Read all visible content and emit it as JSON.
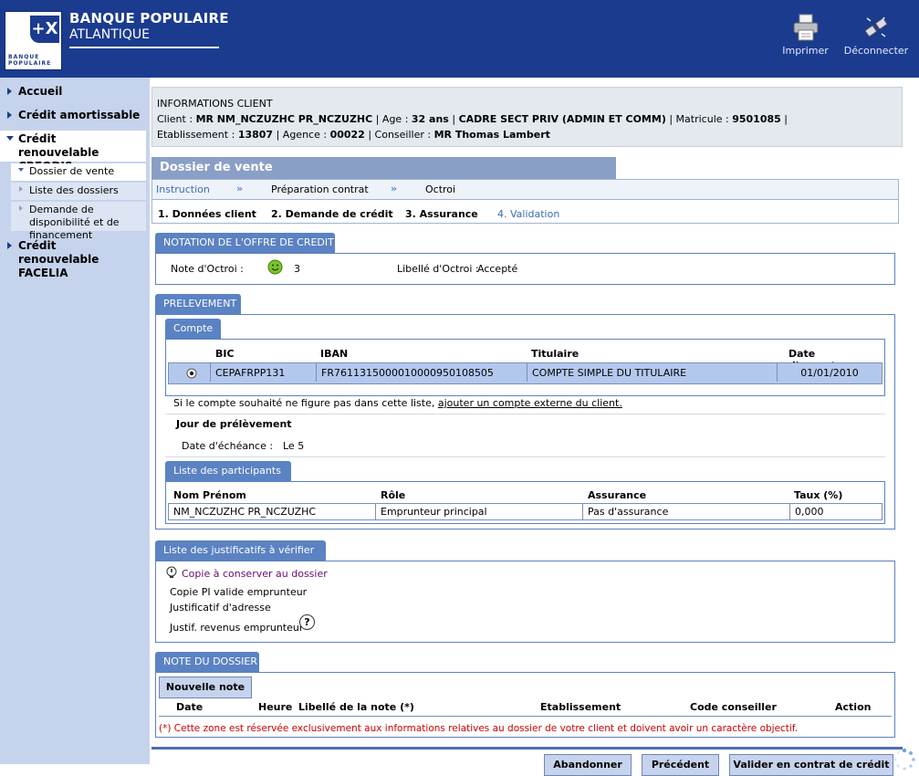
{
  "header": {
    "logo_mark": "+X",
    "logo_text1": "BANQUE",
    "logo_text2": "POPULAIRE",
    "bank_name": "BANQUE POPULAIRE",
    "bank_region": "ATLANTIQUE",
    "print_label": "Imprimer",
    "logout_label": "Déconnecter",
    "color": "#1b3b8f"
  },
  "sidebar": {
    "items": [
      {
        "label": "Accueil"
      },
      {
        "label": "Crédit amortissable"
      },
      {
        "label": "Crédit renouvelable CREODIS"
      },
      {
        "label": "Crédit renouvelable FACELIA"
      }
    ],
    "subitems": [
      {
        "label": "Dossier de vente"
      },
      {
        "label": "Liste des dossiers"
      },
      {
        "label": "Demande de disponibilité et de financement"
      }
    ]
  },
  "client_info": {
    "title": "INFORMATIONS CLIENT",
    "client_label": "Client :",
    "client_name": "MR NM_NCZUZHC PR_NCZUZHC",
    "age_label": "Age :",
    "age": "32 ans",
    "profession": "CADRE SECT PRIV (ADMIN ET COMM)",
    "matricule_label": "Matricule :",
    "matricule": "9501085",
    "etab_label": "Etablissement :",
    "etab": "13807",
    "agence_label": "Agence :",
    "agence": "00022",
    "conseiller_label": "Conseiller :",
    "conseiller": "MR Thomas Lambert"
  },
  "dossier": {
    "title": "Dossier de vente",
    "phases": [
      "Instruction",
      "Préparation contrat",
      "Octroi"
    ],
    "steps": [
      "1. Données client",
      "2. Demande de crédit",
      "3. Assurance",
      "4. Validation"
    ]
  },
  "notation": {
    "title": "NOTATION DE L'OFFRE DE CREDIT",
    "note_label": "Note d'Octroi :",
    "note_value": "3",
    "libelle_label": "Libellé d'Octroi :",
    "libelle_value": "Accepté",
    "smiley_color": "#7cc22c"
  },
  "prelevement": {
    "title": "PRELEVEMENT",
    "compte_title": "Compte",
    "columns": [
      "BIC",
      "IBAN",
      "Titulaire",
      "Date d'ouverture"
    ],
    "row": {
      "bic": "CEPAFRPP131",
      "iban": "FR7611315000010000950108505",
      "titulaire": "COMPTE SIMPLE DU TITULAIRE",
      "date": "01/01/2010"
    },
    "note_text": "Si le compte souhaité ne figure pas dans cette liste,",
    "note_link": "ajouter un compte externe du client.",
    "jour_title": "Jour de prélèvement",
    "echeance_label": "Date d'échéance :",
    "echeance_value": "Le 5",
    "participants_title": "Liste des participants",
    "participant_columns": [
      "Nom Prénom",
      "Rôle",
      "Assurance",
      "Taux (%)"
    ],
    "participant_row": {
      "nom": "NM_NCZUZHC PR_NCZUZHC",
      "role": "Emprunteur principal",
      "assurance": "Pas d'assurance",
      "taux": "0,000"
    }
  },
  "justificatifs": {
    "title": "Liste des justificatifs à vérifier",
    "copy_note": "Copie à conserver au dossier",
    "items": [
      "Copie PI valide emprunteur",
      "Justificatif d'adresse",
      "Justif. revenus emprunteur"
    ],
    "help_glyph": "?"
  },
  "note_dossier": {
    "title": "NOTE DU DOSSIER",
    "new_button": "Nouvelle note",
    "columns": [
      "Date",
      "Heure",
      "Libellé de la note (*)",
      "Etablissement",
      "Code conseiller",
      "Action"
    ],
    "disclaimer": "(*) Cette zone est réservée exclusivement aux informations relatives au dossier de votre client et doivent avoir un caractère objectif."
  },
  "footer": {
    "abandon": "Abandonner",
    "previous": "Précédent",
    "validate": "Valider en contrat de crédit"
  },
  "colors": {
    "header_blue": "#1b3b8f",
    "section_blue": "#5b82c2",
    "row_highlight": "#b4c8ee",
    "sidebar_bg": "#c6d3ec",
    "disclaimer_red": "#d00000",
    "copy_note_purple": "#6a0a6a"
  }
}
